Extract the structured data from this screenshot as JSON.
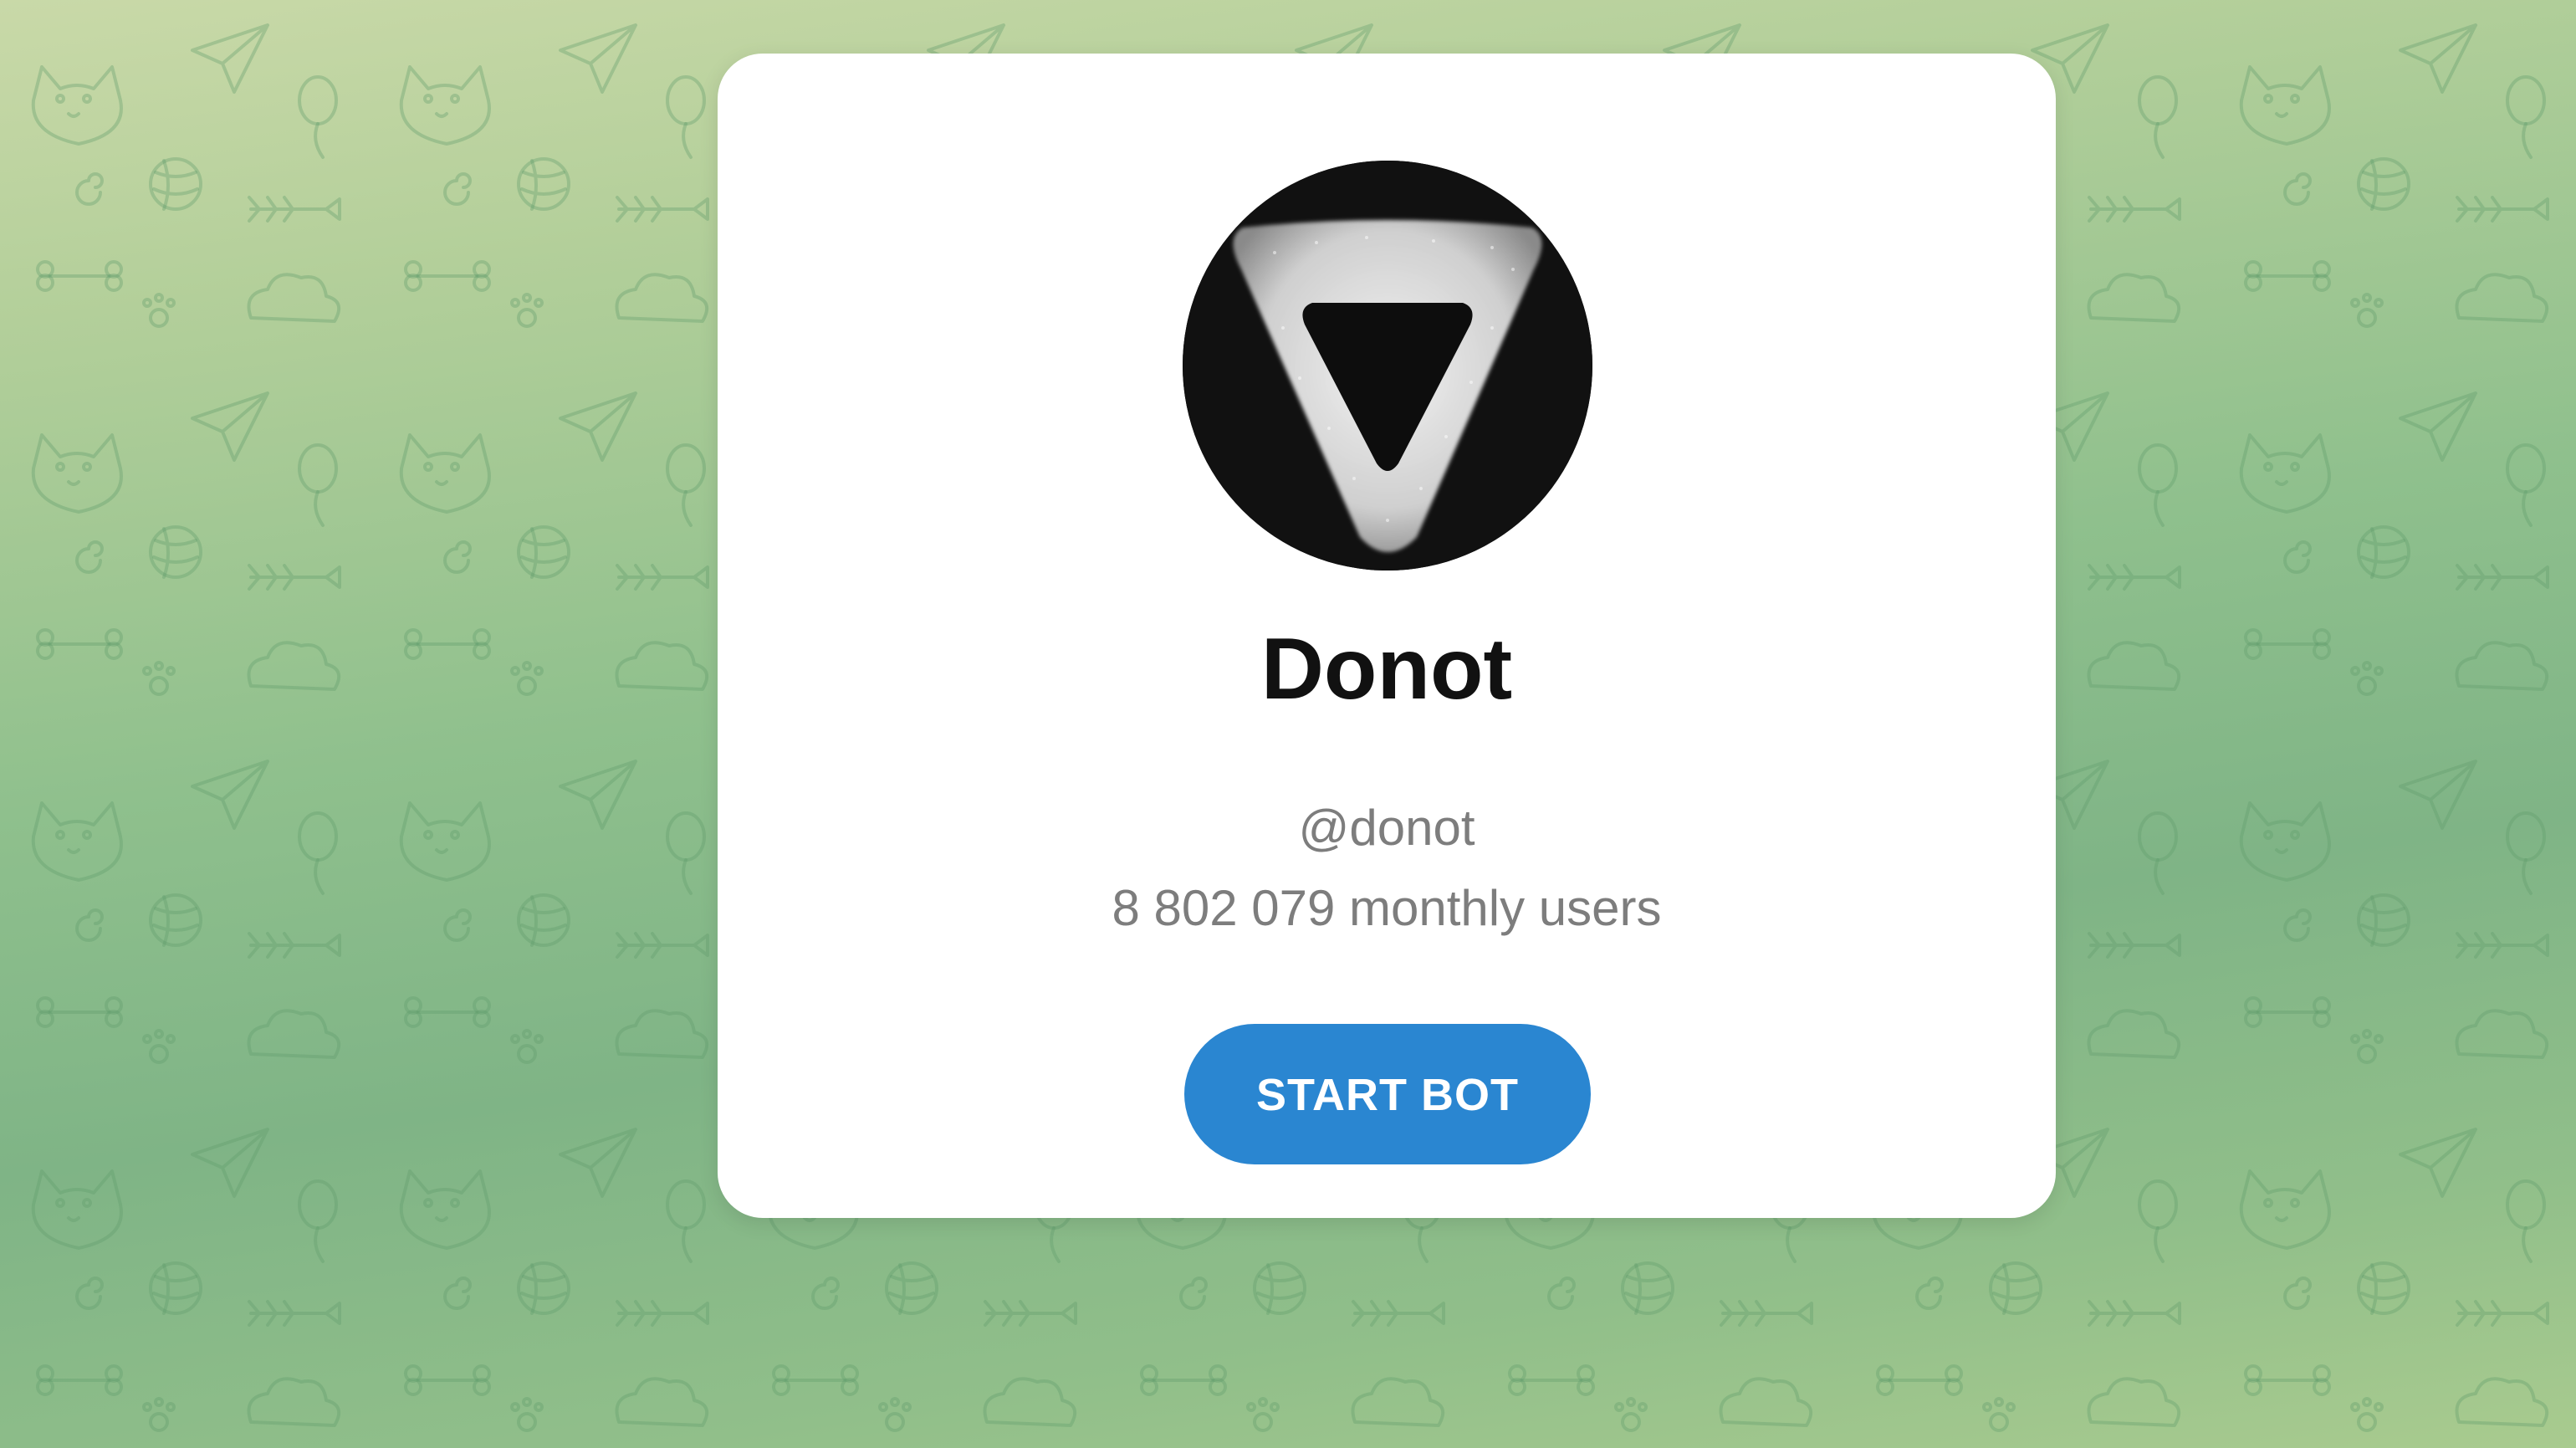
{
  "background": {
    "pattern": "telegram-doodle-pattern"
  },
  "bot": {
    "name": "Donot",
    "username": "@donot",
    "monthly_users": "8 802 079 monthly users",
    "avatar_icon": "triangle-logo-icon"
  },
  "actions": {
    "start_label": "START BOT"
  },
  "colors": {
    "accent": "#2a86d1",
    "card": "#ffffff",
    "muted_text": "#7d7d7d",
    "title_text": "#111111",
    "avatar_bg": "#111111"
  }
}
